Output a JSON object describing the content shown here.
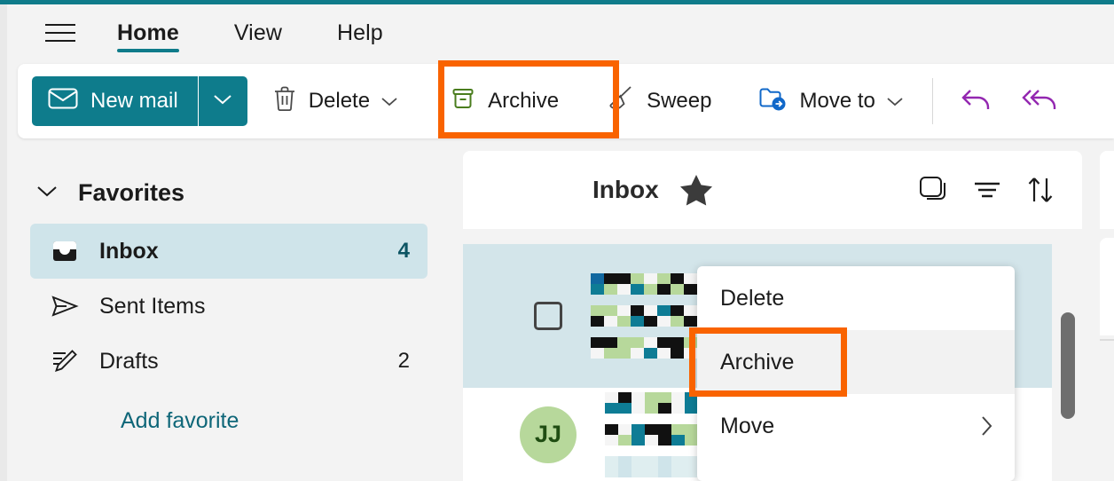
{
  "app": {
    "accent_teal": "#0e7c8c",
    "highlight_orange": "#f96300",
    "selected_row_bg": "#d3e5ea"
  },
  "ribbon": {
    "menu_icon": "hamburger-icon",
    "tabs": [
      {
        "label": "Home",
        "active": true
      },
      {
        "label": "View",
        "active": false
      },
      {
        "label": "Help",
        "active": false
      }
    ]
  },
  "toolbar": {
    "new_mail": {
      "label": "New mail",
      "icon": "envelope-icon",
      "dropdown_icon": "chevron-down-icon"
    },
    "delete": {
      "label": "Delete",
      "icon": "trash-icon",
      "dropdown_icon": "chevron-down-icon"
    },
    "archive": {
      "label": "Archive",
      "icon": "archive-box-icon",
      "highlighted": true
    },
    "sweep": {
      "label": "Sweep",
      "icon": "broom-icon"
    },
    "move_to": {
      "label": "Move to",
      "icon": "folder-arrow-icon",
      "dropdown_icon": "chevron-down-icon"
    },
    "reply": {
      "icon": "reply-icon"
    },
    "reply_all": {
      "icon": "reply-all-icon"
    }
  },
  "sidebar": {
    "section": {
      "label": "Favorites",
      "expand_icon": "chevron-down-icon"
    },
    "items": [
      {
        "label": "Inbox",
        "count": "4",
        "icon": "inbox-icon",
        "selected": true
      },
      {
        "label": "Sent Items",
        "count": "",
        "icon": "send-icon",
        "selected": false
      },
      {
        "label": "Drafts",
        "count": "2",
        "icon": "draft-pencil-icon",
        "selected": false
      }
    ],
    "add_favorite": "Add favorite"
  },
  "message_list": {
    "title": "Inbox",
    "star_icon": "star-filled-icon",
    "actions": [
      {
        "name": "conversation-view-icon"
      },
      {
        "name": "filter-icon"
      },
      {
        "name": "sort-icon"
      }
    ],
    "rows": [
      {
        "selected": true,
        "checkbox": "unchecked",
        "avatar": "",
        "content": "redacted"
      },
      {
        "selected": false,
        "checkbox": "none",
        "avatar": "JJ",
        "content": "redacted"
      }
    ]
  },
  "context_menu": {
    "items": [
      {
        "label": "Delete",
        "hover": false,
        "submenu": false
      },
      {
        "label": "Archive",
        "hover": true,
        "submenu": false,
        "highlighted": true
      },
      {
        "label": "Move",
        "hover": false,
        "submenu": true,
        "submenu_icon": "chevron-right-icon"
      }
    ]
  }
}
